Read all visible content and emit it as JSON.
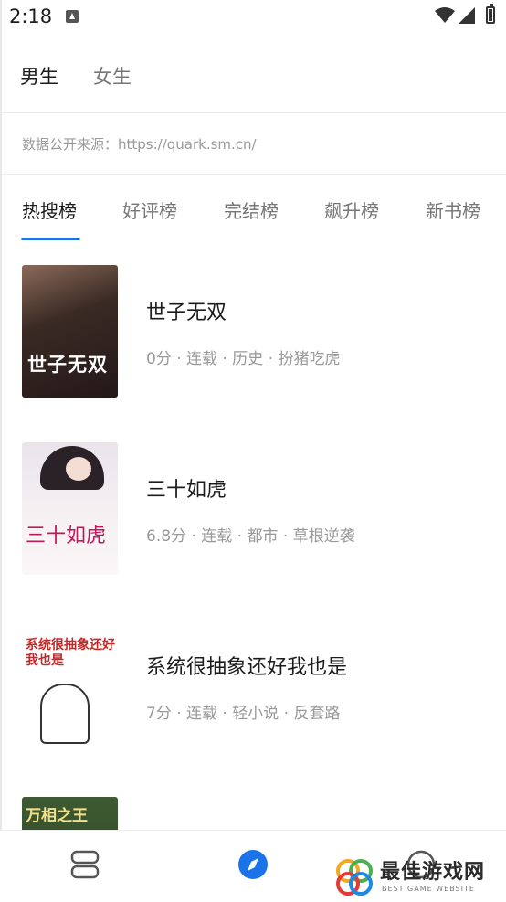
{
  "status_bar": {
    "time": "2:18",
    "icons": [
      "notification-icon",
      "wifi-icon",
      "signal-icon",
      "battery-icon"
    ]
  },
  "gender_tabs": [
    {
      "label": "男生",
      "active": true
    },
    {
      "label": "女生",
      "active": false
    }
  ],
  "source_text": "数据公开来源：https://quark.sm.cn/",
  "rank_tabs": [
    {
      "label": "热搜榜",
      "active": true
    },
    {
      "label": "好评榜",
      "active": false
    },
    {
      "label": "完结榜",
      "active": false
    },
    {
      "label": "飙升榜",
      "active": false
    },
    {
      "label": "新书榜",
      "active": false
    }
  ],
  "books": [
    {
      "title": "世子无双",
      "meta": "0分 · 连载 · 历史 · 扮猪吃虎",
      "cover_text": "世子无双"
    },
    {
      "title": "三十如虎",
      "meta": "6.8分 · 连载 · 都市 · 草根逆袭",
      "cover_text": "三十如虎"
    },
    {
      "title": "系统很抽象还好我也是",
      "meta": "7分 · 连载 · 轻小说 · 反套路",
      "cover_text": "系统很抽象还好我也是"
    },
    {
      "title": "",
      "meta": "",
      "cover_text": "万相之王"
    }
  ],
  "bottom_nav": [
    {
      "icon": "bookshelf-icon",
      "active": false
    },
    {
      "icon": "compass-icon",
      "active": true
    },
    {
      "icon": "profile-icon",
      "active": false
    }
  ],
  "watermark": {
    "title": "最佳游戏网",
    "subtitle": "BEST GAME WEBSITE"
  },
  "colors": {
    "accent": "#1a73e8",
    "text_primary": "#1c1c1c",
    "text_secondary": "#999999"
  }
}
